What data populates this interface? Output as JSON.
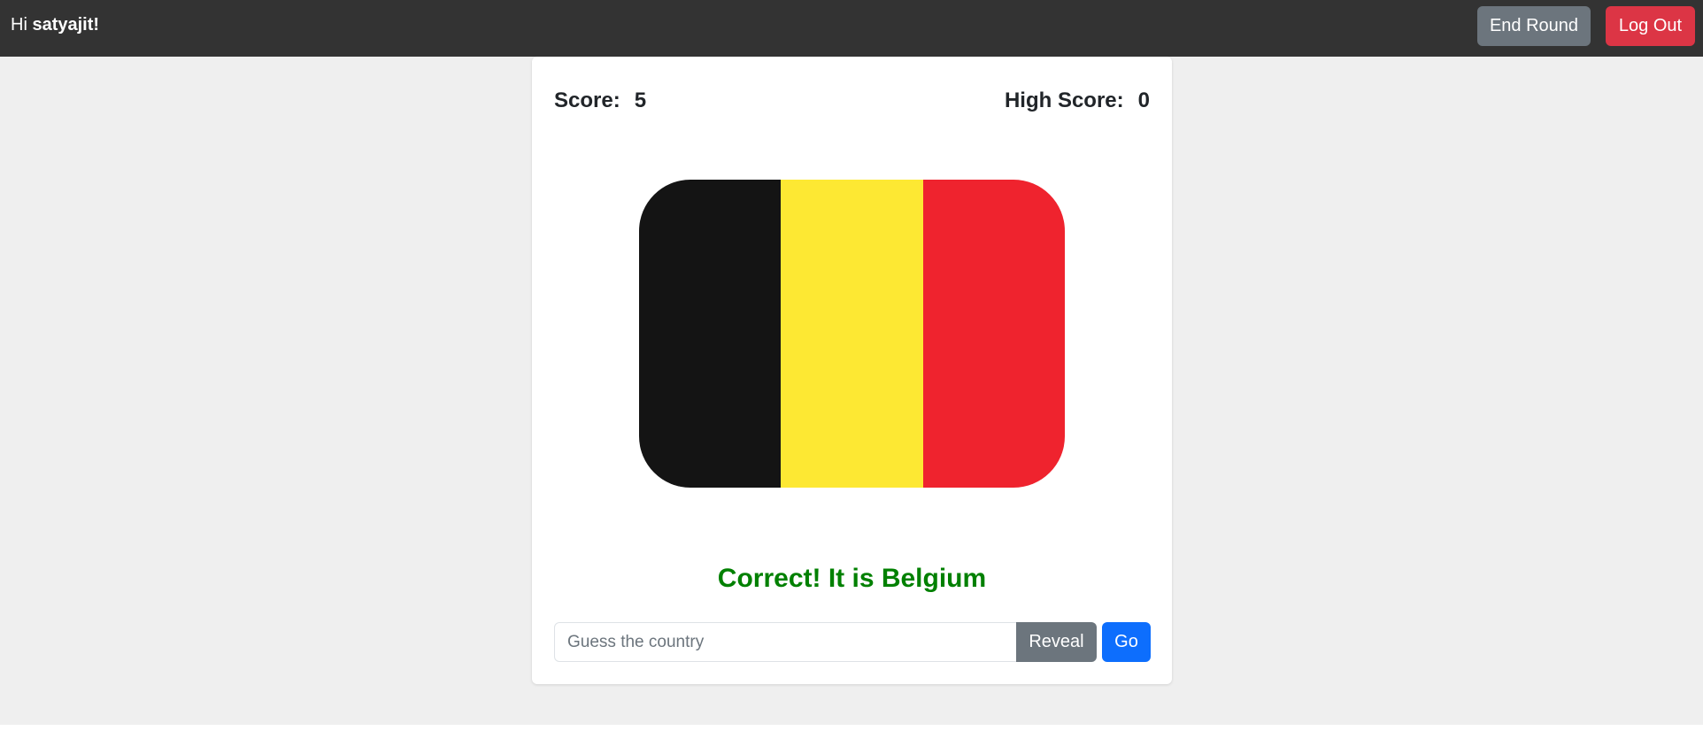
{
  "navbar": {
    "greeting_prefix": "Hi ",
    "username": "satyajit!",
    "end_round_label": "End Round",
    "log_out_label": "Log Out"
  },
  "scoreboard": {
    "score_label": "Score:",
    "score_value": "5",
    "high_score_label": "High Score:",
    "high_score_value": "0"
  },
  "flag": {
    "country": "Belgium",
    "stripes": [
      "#141414",
      "#fde833",
      "#ef232e"
    ]
  },
  "result": {
    "message": "Correct! It is Belgium"
  },
  "guess": {
    "placeholder": "Guess the country",
    "value": "",
    "reveal_label": "Reveal",
    "go_label": "Go"
  },
  "colors": {
    "navbar_bg": "#333333",
    "page_bg": "#efefef",
    "end_round_bg": "#6c757d",
    "log_out_bg": "#dc3545",
    "reveal_bg": "#6c757d",
    "go_bg": "#0d6efd",
    "correct_text": "#008000"
  }
}
